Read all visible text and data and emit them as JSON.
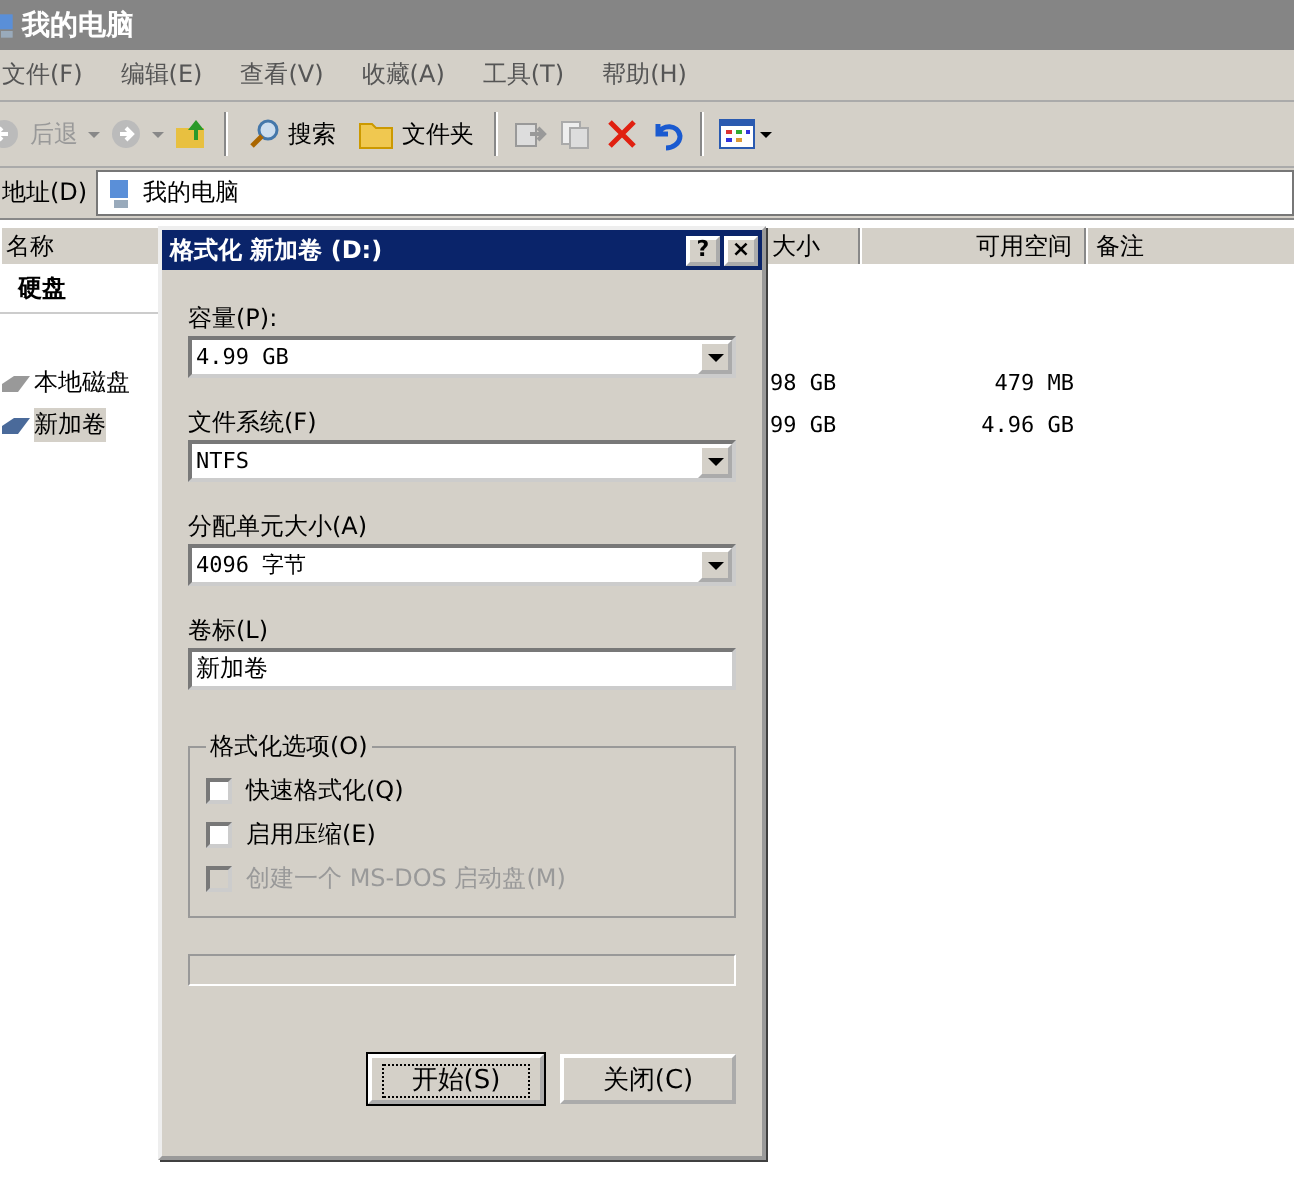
{
  "window": {
    "title": "我的电脑"
  },
  "menu": [
    "文件(F)",
    "编辑(E)",
    "查看(V)",
    "收藏(A)",
    "工具(T)",
    "帮助(H)"
  ],
  "toolbar": {
    "back": "后退",
    "search": "搜索",
    "folders": "文件夹"
  },
  "address": {
    "label": "地址(D)",
    "value": "我的电脑"
  },
  "columns": [
    "名称",
    "大小",
    "可用空间",
    "备注"
  ],
  "group": "硬盘",
  "rows": [
    {
      "name": "本地磁盘",
      "total": "98 GB",
      "free": "479 MB",
      "selected": false
    },
    {
      "name": "新加卷",
      "total": "99 GB",
      "free": "4.96 GB",
      "selected": true
    }
  ],
  "dialog": {
    "title": "格式化 新加卷 (D:)",
    "help": "?",
    "close": "×",
    "fields": [
      {
        "label": "容量(P):",
        "kind": "dropdown",
        "value": "4.99 GB"
      },
      {
        "label": "文件系统(F)",
        "kind": "dropdown",
        "value": "NTFS"
      },
      {
        "label": "分配单元大小(A)",
        "kind": "dropdown",
        "value": "4096 字节"
      },
      {
        "label": "卷标(L)",
        "kind": "text",
        "value": "新加卷"
      }
    ],
    "options_title": "格式化选项(O)",
    "options": [
      {
        "label": "快速格式化(Q)",
        "checked": false,
        "disabled": false
      },
      {
        "label": "启用压缩(E)",
        "checked": false,
        "disabled": false
      },
      {
        "label": "创建一个 MS-DOS 启动盘(M)",
        "checked": false,
        "disabled": true
      }
    ],
    "progress": {
      "level": 0
    },
    "buttons": [
      {
        "label": "开始(S)",
        "default": true
      },
      {
        "label": "关闭(C)",
        "default": false
      }
    ]
  }
}
